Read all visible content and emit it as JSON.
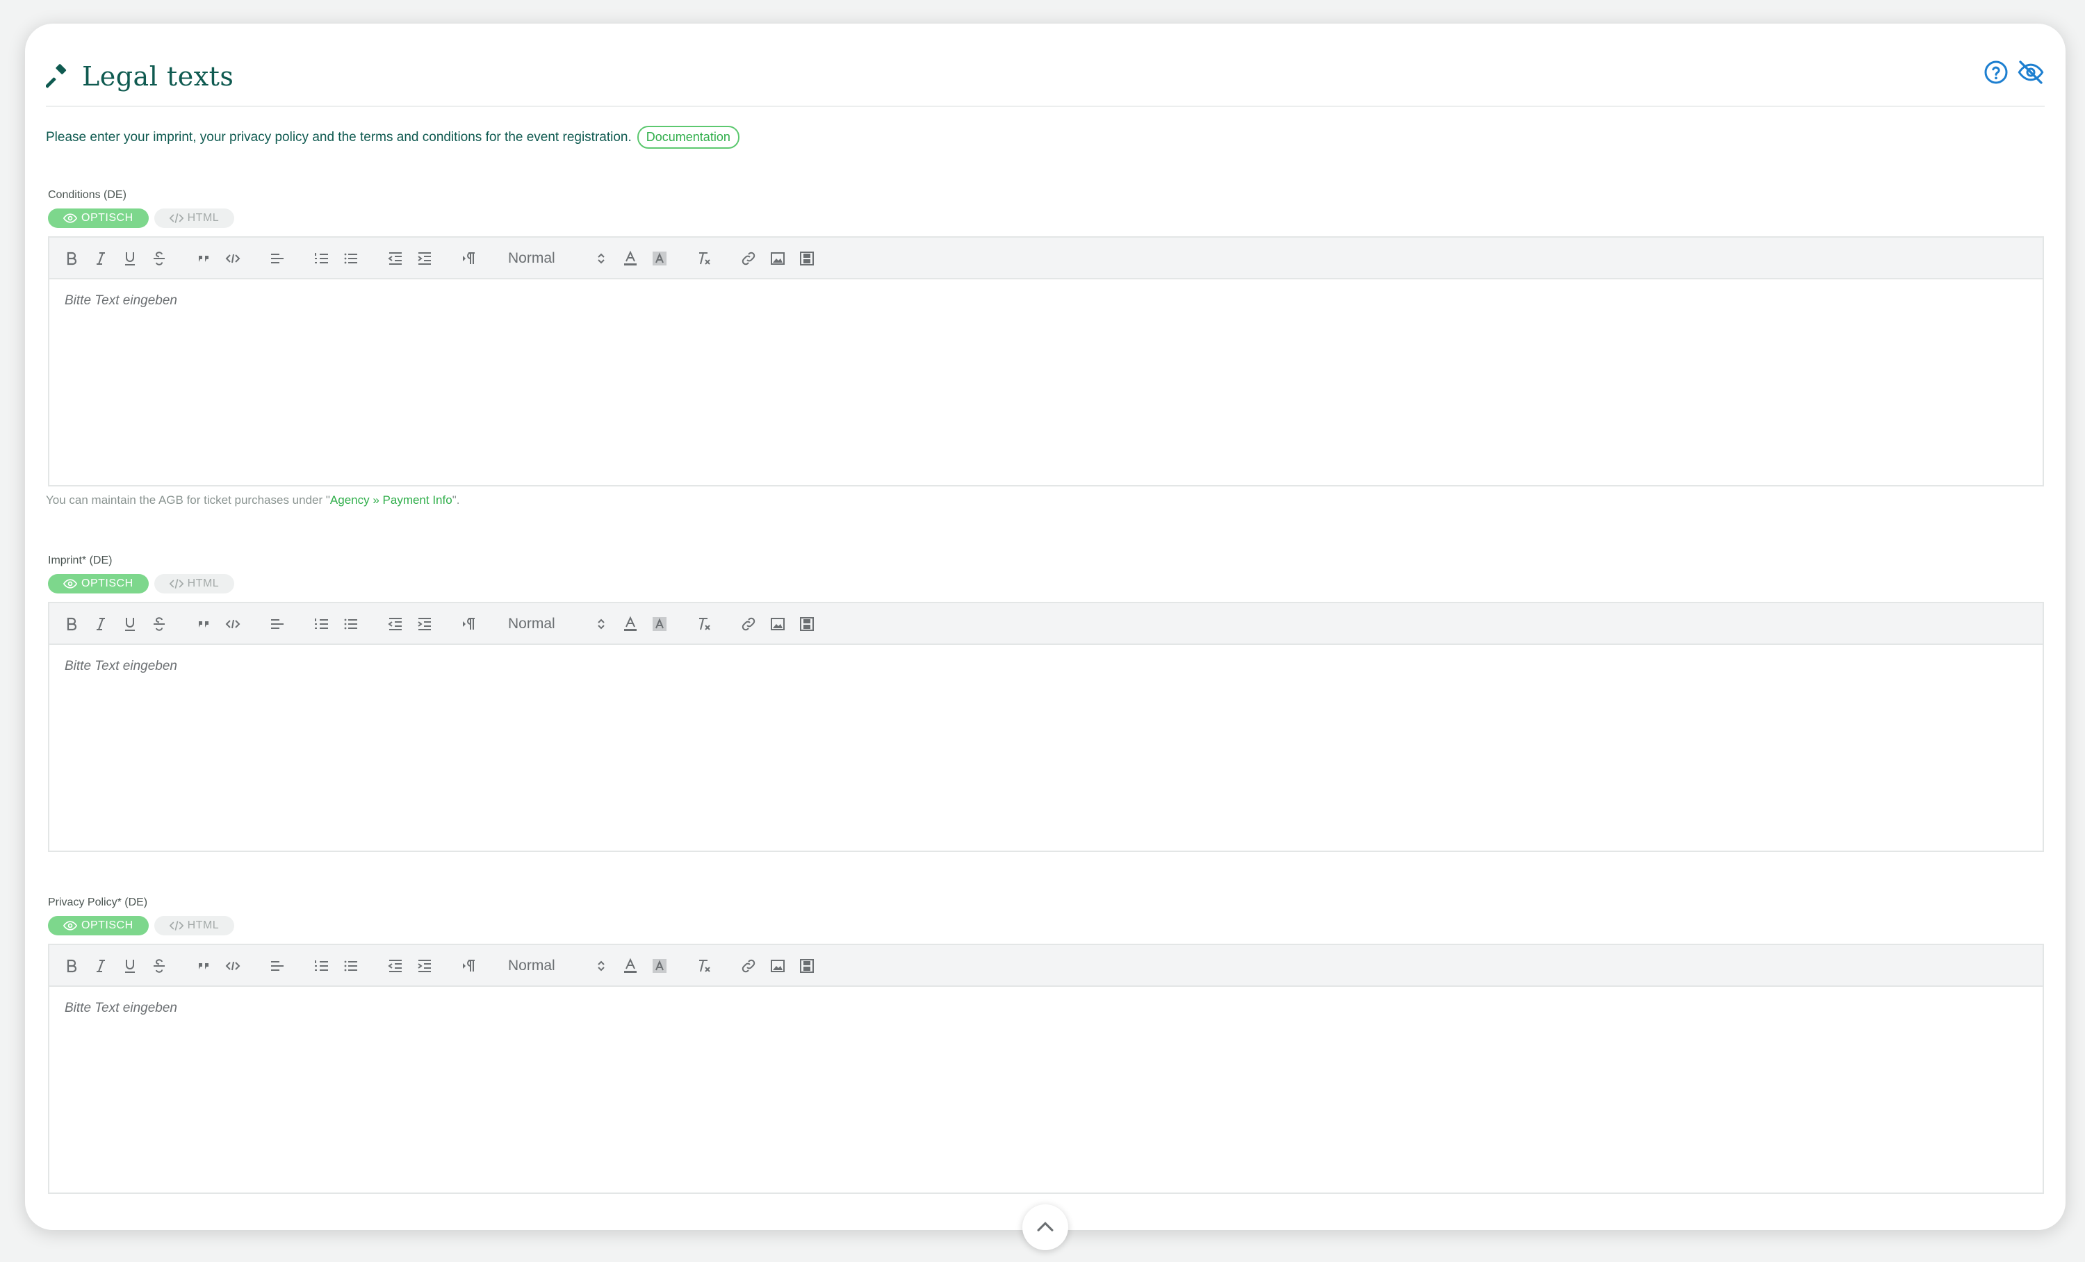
{
  "page": {
    "title": "Legal texts",
    "intro": "Please enter your imprint, your privacy policy and the terms and conditions for the event registration.",
    "documentation_label": "Documentation"
  },
  "header_icons": [
    "help-circle-icon",
    "eye-off-icon"
  ],
  "editor": {
    "mode_visual": "OPTISCH",
    "mode_html": "HTML",
    "format_select": "Normal",
    "placeholder": "Bitte Text eingeben",
    "toolbar_buttons": [
      "bold",
      "italic",
      "underline",
      "strikethrough",
      "blockquote",
      "code",
      "align-left",
      "ordered-list",
      "bullet-list",
      "outdent",
      "indent",
      "text-direction",
      "format",
      "text-color",
      "background-color",
      "clear-format",
      "link",
      "image",
      "video"
    ]
  },
  "fields": [
    {
      "label": "Conditions (DE)"
    },
    {
      "label": "Imprint* (DE)"
    },
    {
      "label": "Privacy Policy* (DE)"
    }
  ],
  "hint": {
    "prefix": "You can maintain the AGB for ticket purchases under \"",
    "link": "Agency » Payment Info",
    "suffix": "\"."
  },
  "colors": {
    "brand": "#0f5a50",
    "accent_green": "#7dd78c",
    "link_green": "#2fae4a",
    "icon_blue": "#1d7fd0"
  }
}
